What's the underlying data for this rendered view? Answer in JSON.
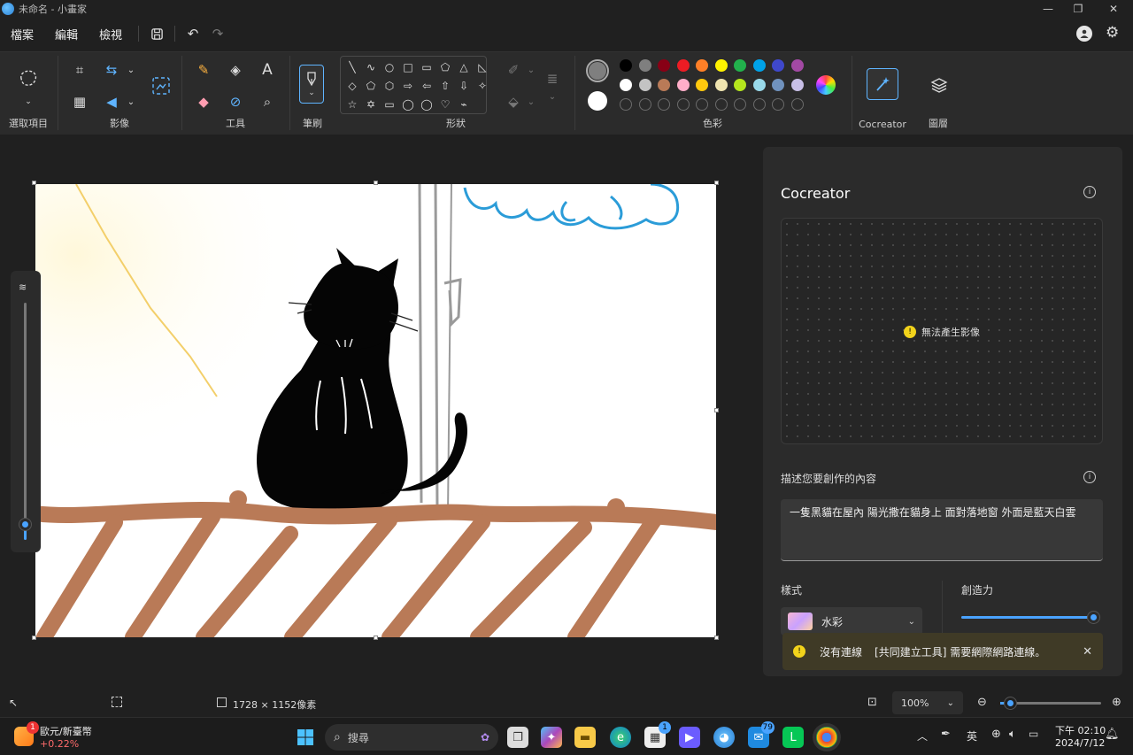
{
  "window": {
    "title": "未命名 - 小畫家"
  },
  "menu": {
    "items": [
      "檔案",
      "編輯",
      "檢視"
    ]
  },
  "ribbon": {
    "groups": {
      "select": "選取項目",
      "image": "影像",
      "tools": "工具",
      "brushes": "筆刷",
      "shapes": "形狀",
      "colors": "色彩",
      "cocreator": "Cocreator",
      "layers": "圖層"
    },
    "shape_glyphs": [
      "╲",
      "∿",
      "○",
      "□",
      "▭",
      "⬠",
      "△",
      "◺",
      "◇",
      "⬠",
      "⬡",
      "⇨",
      "⇦",
      "⇧",
      "⇩",
      "✧",
      "☆",
      "✡",
      "▭",
      "◯",
      "◯",
      "♡",
      "⌁"
    ],
    "palette_row1": [
      "#000000",
      "#7f7f7f",
      "#880015",
      "#ed1c24",
      "#ff7f27",
      "#fff200",
      "#22b14c",
      "#00a2e8",
      "#3f48cc",
      "#a349a4"
    ],
    "palette_row2": [
      "#ffffff",
      "#c3c3c3",
      "#b97a57",
      "#ffaec9",
      "#ffc90e",
      "#efe4b0",
      "#b5e61d",
      "#99d9ea",
      "#7092be",
      "#c8bfe7"
    ],
    "primary_color": "#7f7f7f",
    "secondary_color": "#ffffff"
  },
  "panel": {
    "title": "Cocreator",
    "error_message": "無法產生影像",
    "prompt_label": "描述您要創作的內容",
    "prompt_text": "一隻黑貓在屋內 陽光撒在貓身上 面對落地窗 外面是藍天白雲",
    "style_label": "樣式",
    "style_value": "水彩",
    "creativity_label": "創造力",
    "creativity_level": 1.0
  },
  "toast": {
    "title": "沒有連線",
    "message": "[共同建立工具] 需要網際網路連線。"
  },
  "status": {
    "canvas_size": "1728 × 1152像素",
    "zoom": "100%"
  },
  "taskbar": {
    "weather_title": "歐元/新臺幣",
    "weather_value": "+0.22%",
    "weather_badge": "1",
    "search_placeholder": "搜尋",
    "store_badge": "1",
    "mail_badge": "79",
    "ime": "英",
    "time": "下午 02:10",
    "date": "2024/7/12"
  }
}
